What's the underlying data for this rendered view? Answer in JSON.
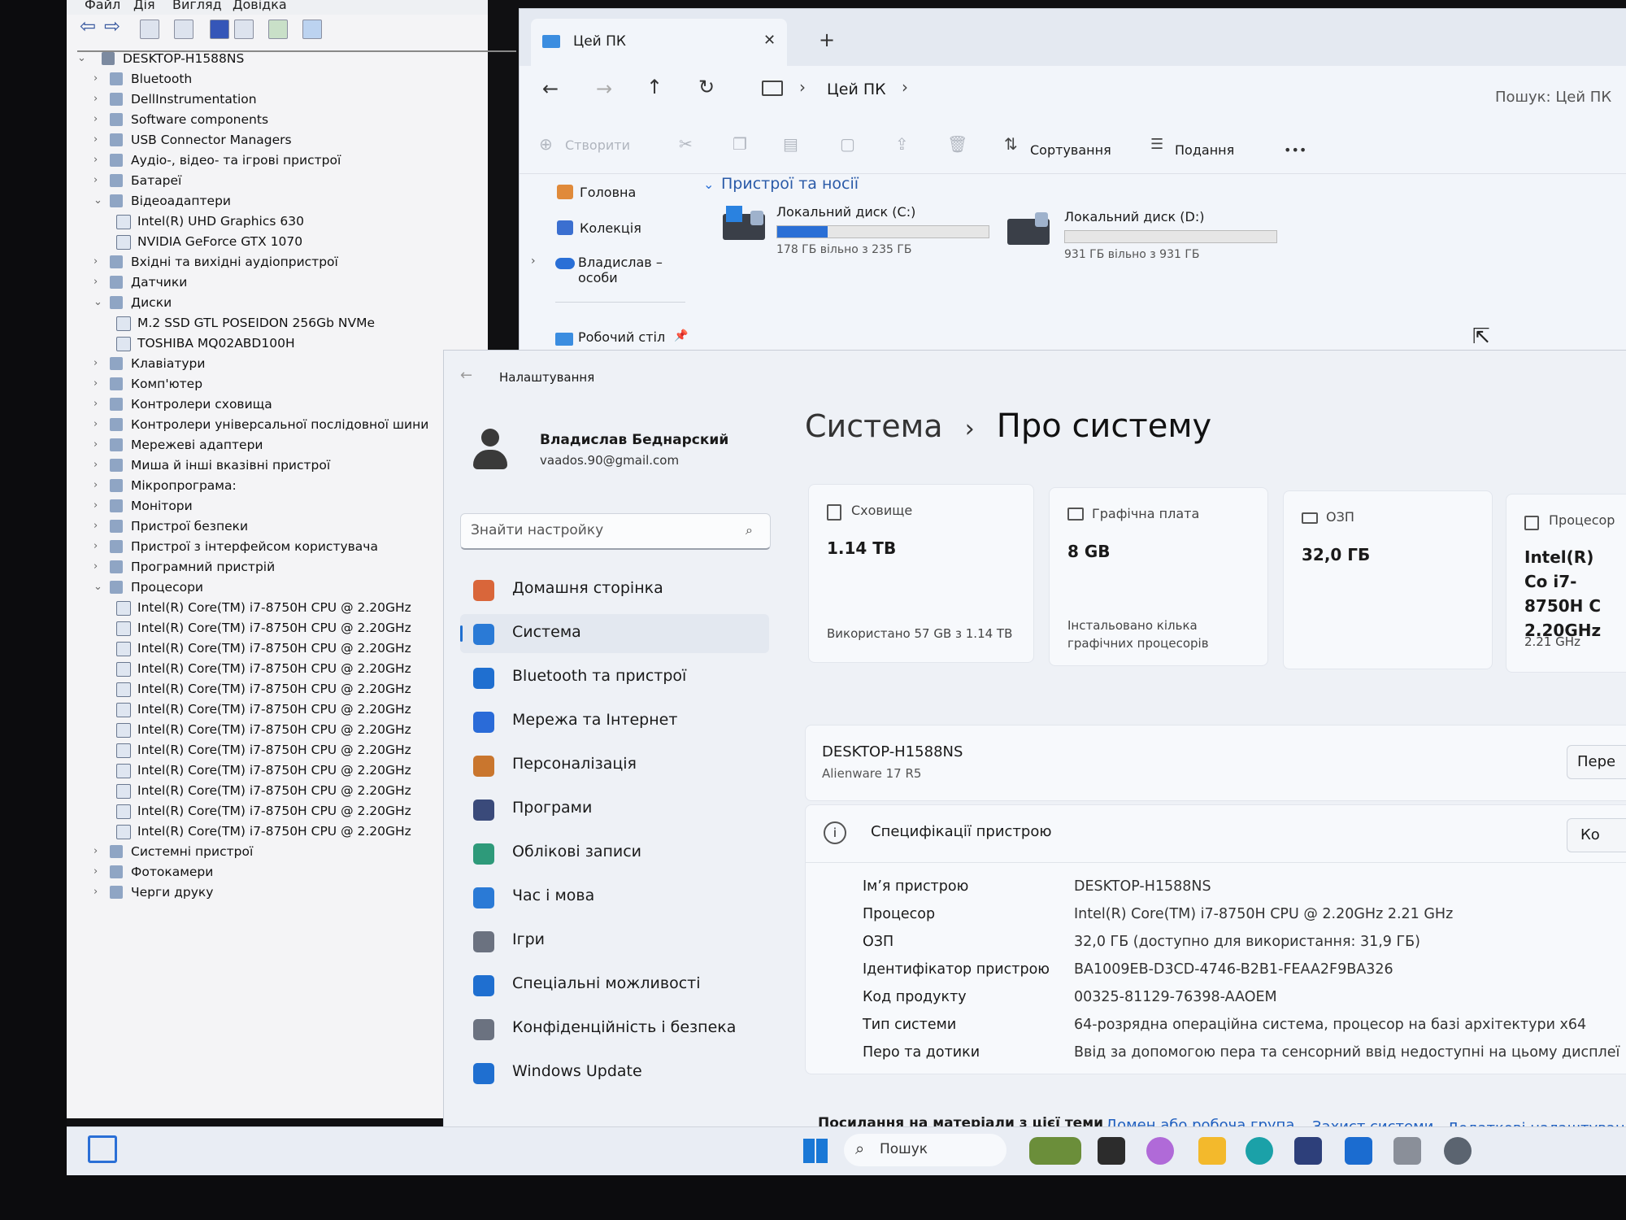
{
  "devmgr": {
    "menu": [
      "Файл",
      "Дія",
      "Вигляд",
      "Довідка"
    ],
    "root": "DESKTOP-H1588NS",
    "items": [
      {
        "label": "Bluetooth",
        "expanded": false
      },
      {
        "label": "DellInstrumentation",
        "expanded": false
      },
      {
        "label": "Software components",
        "expanded": false
      },
      {
        "label": "USB Connector Managers",
        "expanded": false
      },
      {
        "label": "Аудіо-, відео- та ігрові пристрої",
        "expanded": false
      },
      {
        "label": "Батареї",
        "expanded": false
      },
      {
        "label": "Відеоадаптери",
        "expanded": true
      },
      {
        "label": "Intel(R) UHD Graphics 630",
        "child": true
      },
      {
        "label": "NVIDIA GeForce GTX 1070",
        "child": true
      },
      {
        "label": "Вхідні та вихідні аудіопристрої",
        "expanded": false
      },
      {
        "label": "Датчики",
        "expanded": false
      },
      {
        "label": "Диски",
        "expanded": true
      },
      {
        "label": "M.2 SSD GTL POSEIDON 256Gb NVMe",
        "child": true
      },
      {
        "label": "TOSHIBA MQ02ABD100H",
        "child": true
      },
      {
        "label": "Клавіатури",
        "expanded": false
      },
      {
        "label": "Комп'ютер",
        "expanded": false
      },
      {
        "label": "Контролери сховища",
        "expanded": false
      },
      {
        "label": "Контролери універсальної послідовної шини",
        "expanded": false
      },
      {
        "label": "Мережеві адаптери",
        "expanded": false
      },
      {
        "label": "Миша й інші вказівні пристрої",
        "expanded": false
      },
      {
        "label": "Мікропрограма:",
        "expanded": false
      },
      {
        "label": "Монітори",
        "expanded": false
      },
      {
        "label": "Пристрої безпеки",
        "expanded": false
      },
      {
        "label": "Пристрої з інтерфейсом користувача",
        "expanded": false
      },
      {
        "label": "Програмний пристрій",
        "expanded": false
      },
      {
        "label": "Процесори",
        "expanded": true
      },
      {
        "label": "Intel(R) Core(TM) i7-8750H CPU @ 2.20GHz",
        "child": true
      },
      {
        "label": "Intel(R) Core(TM) i7-8750H CPU @ 2.20GHz",
        "child": true
      },
      {
        "label": "Intel(R) Core(TM) i7-8750H CPU @ 2.20GHz",
        "child": true
      },
      {
        "label": "Intel(R) Core(TM) i7-8750H CPU @ 2.20GHz",
        "child": true
      },
      {
        "label": "Intel(R) Core(TM) i7-8750H CPU @ 2.20GHz",
        "child": true
      },
      {
        "label": "Intel(R) Core(TM) i7-8750H CPU @ 2.20GHz",
        "child": true
      },
      {
        "label": "Intel(R) Core(TM) i7-8750H CPU @ 2.20GHz",
        "child": true
      },
      {
        "label": "Intel(R) Core(TM) i7-8750H CPU @ 2.20GHz",
        "child": true
      },
      {
        "label": "Intel(R) Core(TM) i7-8750H CPU @ 2.20GHz",
        "child": true
      },
      {
        "label": "Intel(R) Core(TM) i7-8750H CPU @ 2.20GHz",
        "child": true
      },
      {
        "label": "Intel(R) Core(TM) i7-8750H CPU @ 2.20GHz",
        "child": true
      },
      {
        "label": "Intel(R) Core(TM) i7-8750H CPU @ 2.20GHz",
        "child": true
      },
      {
        "label": "Системні пристрої",
        "expanded": false
      },
      {
        "label": "Фотокамери",
        "expanded": false
      },
      {
        "label": "Черги друку",
        "expanded": false
      }
    ]
  },
  "explorer": {
    "tab_title": "Цей ПК",
    "tab_close": "✕",
    "new_tab": "+",
    "breadcrumb": "Цей ПК",
    "search_placeholder": "Пошук: Цей ПК",
    "create_label": "Створити",
    "sort_label": "Сортування",
    "view_label": "Подання",
    "more_label": "•••",
    "sidebar": {
      "home": "Головна",
      "gallery": "Колекція",
      "onedrive": "Владислав – особи",
      "desktop": "Робочий стіл"
    },
    "section_title": "Пристрої та носії",
    "drives": [
      {
        "name": "Локальний диск (C:)",
        "info": "178 ГБ вільно з 235 ГБ",
        "used_fraction": 0.24
      },
      {
        "name": "Локальний диск (D:)",
        "info": "931 ГБ вільно з 931 ГБ",
        "used_fraction": 0.0
      }
    ]
  },
  "settings": {
    "app_title": "Налаштування",
    "user_name": "Владислав Беднарский",
    "user_email": "vaados.90@gmail.com",
    "search_placeholder": "Знайти настройку",
    "nav": [
      {
        "label": "Домашня сторінка",
        "icon": "home-icon",
        "color": "#d9663a"
      },
      {
        "label": "Система",
        "icon": "system-icon",
        "color": "#2a7ad6",
        "active": true
      },
      {
        "label": "Bluetooth та пристрої",
        "icon": "bluetooth-icon",
        "color": "#1f6fd0"
      },
      {
        "label": "Мережа та Інтернет",
        "icon": "wifi-icon",
        "color": "#2a6bd8"
      },
      {
        "label": "Персоналізація",
        "icon": "brush-icon",
        "color": "#c9762e"
      },
      {
        "label": "Програми",
        "icon": "apps-icon",
        "color": "#3a4a7a"
      },
      {
        "label": "Облікові записи",
        "icon": "account-icon",
        "color": "#2e9a7a"
      },
      {
        "label": "Час і мова",
        "icon": "clock-globe-icon",
        "color": "#2a7ad6"
      },
      {
        "label": "Ігри",
        "icon": "gamepad-icon",
        "color": "#6b7280"
      },
      {
        "label": "Спеціальні можливості",
        "icon": "accessibility-icon",
        "color": "#1f6fd0"
      },
      {
        "label": "Конфіденційність і безпека",
        "icon": "shield-icon",
        "color": "#6b7280"
      },
      {
        "label": "Windows Update",
        "icon": "update-icon",
        "color": "#1f6fd0"
      }
    ],
    "heading_parent": "Система",
    "heading_sep": "›",
    "heading_current": "Про систему",
    "cards": [
      {
        "label": "Сховище",
        "value": "1.14 TB",
        "sub": "Використано 57 GB з 1.14 TB"
      },
      {
        "label": "Графічна плата",
        "value": "8 GB",
        "sub": "Інстальовано кілька графічних процесорів"
      },
      {
        "label": "ОЗП",
        "value": "32,0 ГБ",
        "sub": ""
      },
      {
        "label": "Процесор",
        "value": "Intel(R) Co i7-8750H C 2.20GHz",
        "sub": "2.21 GHz"
      }
    ],
    "device_name": "DESKTOP-H1588NS",
    "device_model": "Alienware 17 R5",
    "rename_button": "Пере",
    "spec_title": "Специфікації пристрою",
    "copy_button": "Ко",
    "specs": [
      {
        "label": "Ім’я пристрою",
        "value": "DESKTOP-H1588NS"
      },
      {
        "label": "Процесор",
        "value": "Intel(R) Core(TM) i7-8750H CPU @ 2.20GHz   2.21 GHz"
      },
      {
        "label": "ОЗП",
        "value": "32,0 ГБ (доступно для використання: 31,9 ГБ)"
      },
      {
        "label": "Ідентифікатор пристрою",
        "value": "BA1009EB-D3CD-4746-B2B1-FEAA2F9BA326"
      },
      {
        "label": "Код продукту",
        "value": "00325-81129-76398-AAOEM"
      },
      {
        "label": "Тип системи",
        "value": "64-розрядна операційна система, процесор на базі архітектури x64"
      },
      {
        "label": "Перо та дотики",
        "value": "Ввід за допомогою пера та сенсорний ввід недоступні на цьому дисплеї"
      }
    ],
    "related_label": "Посилання на матеріали з цієї теми",
    "related_links": [
      "Домен або робоча група",
      "Захист системи",
      "Додаткові налаштування"
    ]
  },
  "taskbar": {
    "search_placeholder": "Пошук"
  }
}
